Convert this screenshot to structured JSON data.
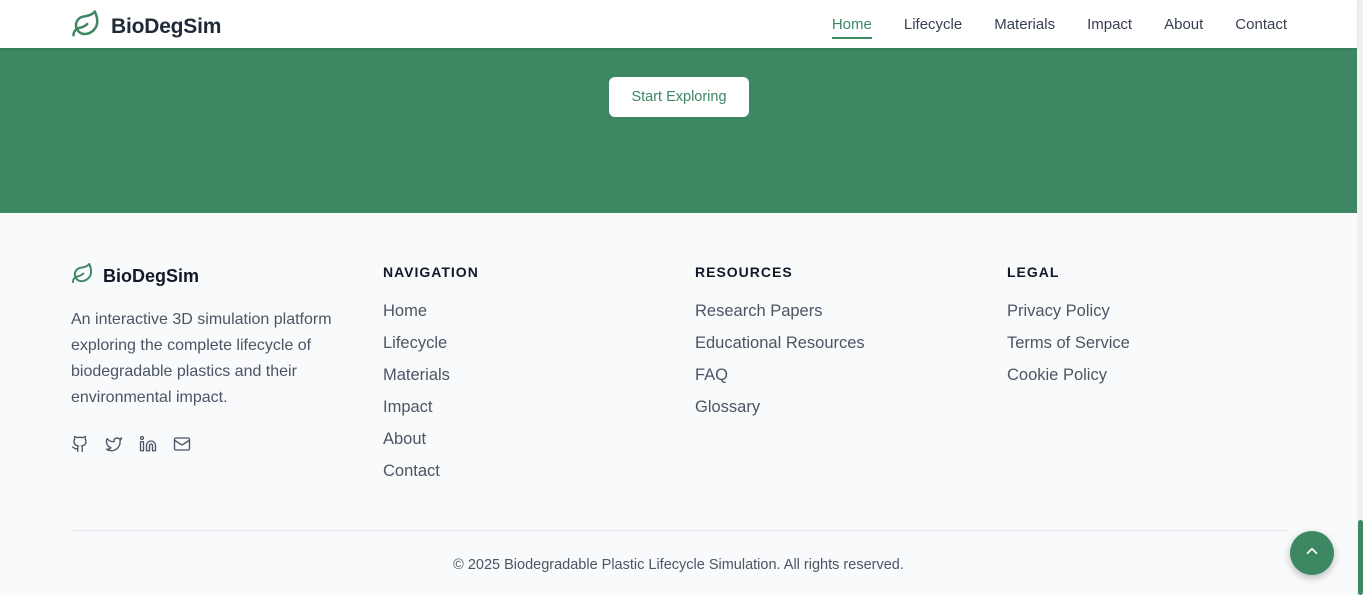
{
  "app": {
    "name": "BioDegSim",
    "brand_color": "#3d8763"
  },
  "header": {
    "nav": [
      {
        "label": "Home",
        "active": true
      },
      {
        "label": "Lifecycle",
        "active": false
      },
      {
        "label": "Materials",
        "active": false
      },
      {
        "label": "Impact",
        "active": false
      },
      {
        "label": "About",
        "active": false
      },
      {
        "label": "Contact",
        "active": false
      }
    ]
  },
  "hero": {
    "cta_label": "Start Exploring",
    "background": "#3d8763"
  },
  "footer": {
    "brand_name": "BioDegSim",
    "description": "An interactive 3D simulation platform exploring the complete lifecycle of biodegradable plastics and their environmental impact.",
    "social_icons": [
      "github-icon",
      "twitter-icon",
      "linkedin-icon",
      "mail-icon"
    ],
    "navigation": {
      "heading": "NAVIGATION",
      "links": [
        "Home",
        "Lifecycle",
        "Materials",
        "Impact",
        "About",
        "Contact"
      ]
    },
    "resources": {
      "heading": "RESOURCES",
      "links": [
        "Research Papers",
        "Educational Resources",
        "FAQ",
        "Glossary"
      ]
    },
    "legal": {
      "heading": "LEGAL",
      "links": [
        "Privacy Policy",
        "Terms of Service",
        "Cookie Policy"
      ]
    },
    "copyright": "© 2025 Biodegradable Plastic Lifecycle Simulation. All rights reserved."
  },
  "scroll_to_top_icon": "chevron-up-icon"
}
